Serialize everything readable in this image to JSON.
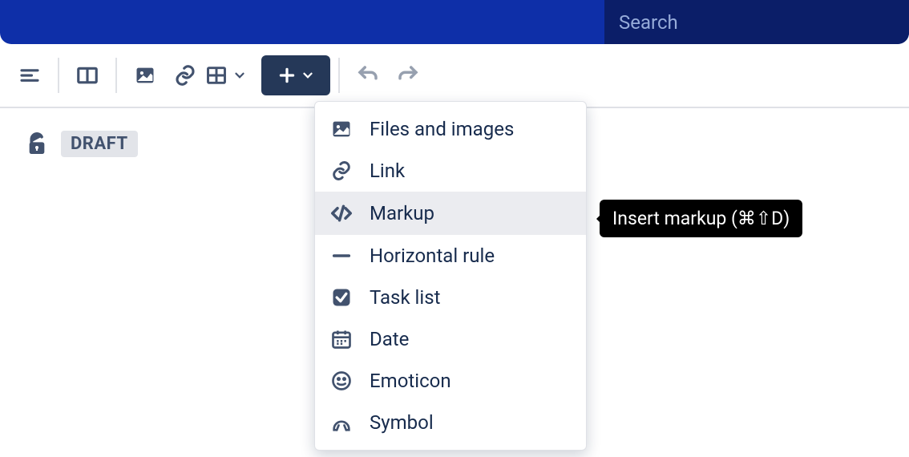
{
  "search": {
    "placeholder": "Search"
  },
  "badge": {
    "draft": "DRAFT"
  },
  "toolbar": {
    "align": "align-left",
    "layout": "layouts",
    "image": "image",
    "link": "link",
    "table": "table"
  },
  "dropdown": {
    "items": [
      {
        "label": "Files and images",
        "icon": "image-icon"
      },
      {
        "label": "Link",
        "icon": "link-icon"
      },
      {
        "label": "Markup",
        "icon": "code-icon"
      },
      {
        "label": "Horizontal rule",
        "icon": "hr-icon"
      },
      {
        "label": "Task list",
        "icon": "checkbox-icon"
      },
      {
        "label": "Date",
        "icon": "calendar-icon"
      },
      {
        "label": "Emoticon",
        "icon": "smile-icon"
      },
      {
        "label": "Symbol",
        "icon": "omega-icon"
      }
    ]
  },
  "tooltip": {
    "text": "Insert markup (⌘⇧D)"
  }
}
